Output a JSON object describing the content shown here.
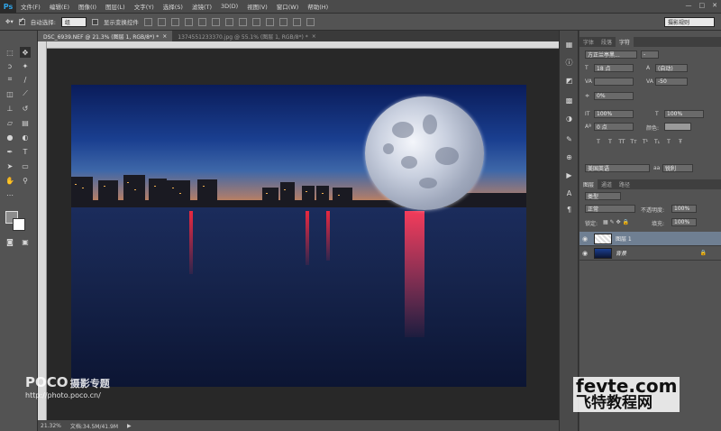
{
  "app": {
    "logo": "Ps"
  },
  "menu": [
    "文件(F)",
    "编辑(E)",
    "图像(I)",
    "图层(L)",
    "文字(Y)",
    "选择(S)",
    "滤镜(T)",
    "3D(D)",
    "视图(V)",
    "窗口(W)",
    "帮助(H)"
  ],
  "window_controls": {
    "minimize": "—",
    "restore": "□",
    "close": "✕"
  },
  "options": {
    "auto_select_label": "自动选择:",
    "auto_select_checked": true,
    "auto_select_value": "组",
    "show_transform_label": "显示变换控件",
    "show_transform_checked": false,
    "workspace": "摄影规则"
  },
  "tabs": [
    {
      "label": "DSC_6939.NEF @ 21.3% (图层 1, RGB/8*) *",
      "close": "×",
      "active": true
    },
    {
      "label": "1374551233370.jpg @ 55.1% (图层 1, RGB/8*) *",
      "close": "×",
      "active": false
    }
  ],
  "statusbar": {
    "zoom": "21.32%",
    "doc": "文档:34.5M/41.9M",
    "arrow": "▶"
  },
  "character_panel": {
    "tabs": [
      "字体",
      "段落",
      "字符"
    ],
    "active_tab": "字符",
    "font_family": "方正兰亭黑...",
    "font_style": "-",
    "font_size": "18 点",
    "leading": "(自动)",
    "kerning": "",
    "tracking": "-50",
    "scale_pct": "0%",
    "vertical_scale": "100%",
    "horizontal_scale": "100%",
    "baseline_shift": "0 点",
    "color_label": "颜色:",
    "style_buttons": [
      "T",
      "T",
      "TT",
      "Tт",
      "T¹",
      "T₁",
      "T",
      "Ŧ"
    ],
    "language": "美国英语",
    "antialias": "锐利",
    "aa_label": "aa"
  },
  "layers_panel": {
    "tabs": [
      "图层",
      "通道",
      "路径"
    ],
    "active_tab": "图层",
    "filter_label": "类型",
    "blend_mode": "正常",
    "opacity_label": "不透明度:",
    "opacity": "100%",
    "lock_label": "锁定:",
    "fill_label": "填充:",
    "fill": "100%",
    "layers": [
      {
        "name": "图层 1",
        "selected": true,
        "visible": true,
        "locked": false
      },
      {
        "name": "背景",
        "selected": false,
        "visible": true,
        "locked": true
      }
    ]
  },
  "watermarks": {
    "poco_main": "POCO",
    "poco_sub": "摄影专题",
    "poco_url": "http://photo.poco.cn/",
    "fevte_main": "fevte.com",
    "fevte_sub": "飞特教程网"
  },
  "colors": {
    "accent": "#2fa3e6",
    "panel_bg": "#535353",
    "canvas_bg": "#282828",
    "selected_layer": "#6f7f92"
  }
}
